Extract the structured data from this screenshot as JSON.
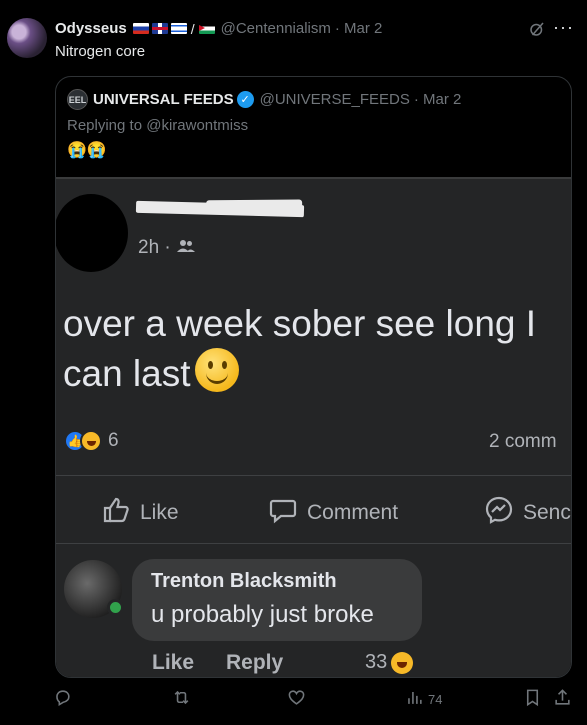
{
  "tweet": {
    "display_name": "Odysseus",
    "flag_icons": [
      "russia-flag-icon",
      "uk-flag-icon",
      "israel-flag-icon",
      "palestine-flag-icon"
    ],
    "flag_separator": "/",
    "handle": "@Centennialism",
    "date": "· Mar 2",
    "text": "Nitrogen core"
  },
  "quote": {
    "logo_text": "EEL",
    "display_name": "UNIVERSAL FEEDS",
    "verified_icon": "verified-badge-icon",
    "handle": "@UNIVERSE_FEEDS",
    "date": "· Mar 2",
    "replying_to": "Replying to @kirawontmiss",
    "emoji": "😭😭"
  },
  "fb_post": {
    "time": "2h ·",
    "text": "over a week sober see long I can last",
    "reaction_count": "6",
    "comments_count": "2 comm",
    "actions": {
      "like": "Like",
      "comment": "Comment",
      "send": "Senc"
    }
  },
  "fb_comment": {
    "author": "Trenton Blacksmith",
    "text": "u probably just broke",
    "like": "Like",
    "reply": "Reply",
    "reaction_count": "33"
  },
  "actions": {
    "views": "74"
  },
  "colors": {
    "background": "#000000",
    "muted": "#71767b",
    "fb_bg": "#242526",
    "accent": "#1d9bf0"
  }
}
